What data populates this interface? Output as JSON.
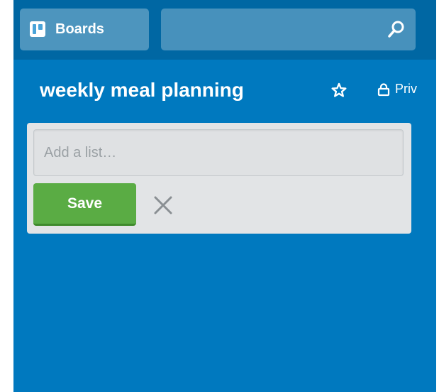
{
  "header": {
    "boards_label": "Boards",
    "boards_icon": "boards-icon",
    "search_icon": "search-icon"
  },
  "board": {
    "title": "weekly meal planning",
    "star_icon": "star-icon",
    "lock_icon": "lock-icon",
    "privacy_label": "Priv"
  },
  "add_list": {
    "placeholder": "Add a list…",
    "value": "",
    "save_label": "Save",
    "close_icon": "close-icon"
  },
  "colors": {
    "board_background": "#0079bf",
    "header_background": "#0067a3",
    "save_button": "#5aac44",
    "panel_background": "#e2e4e6"
  }
}
